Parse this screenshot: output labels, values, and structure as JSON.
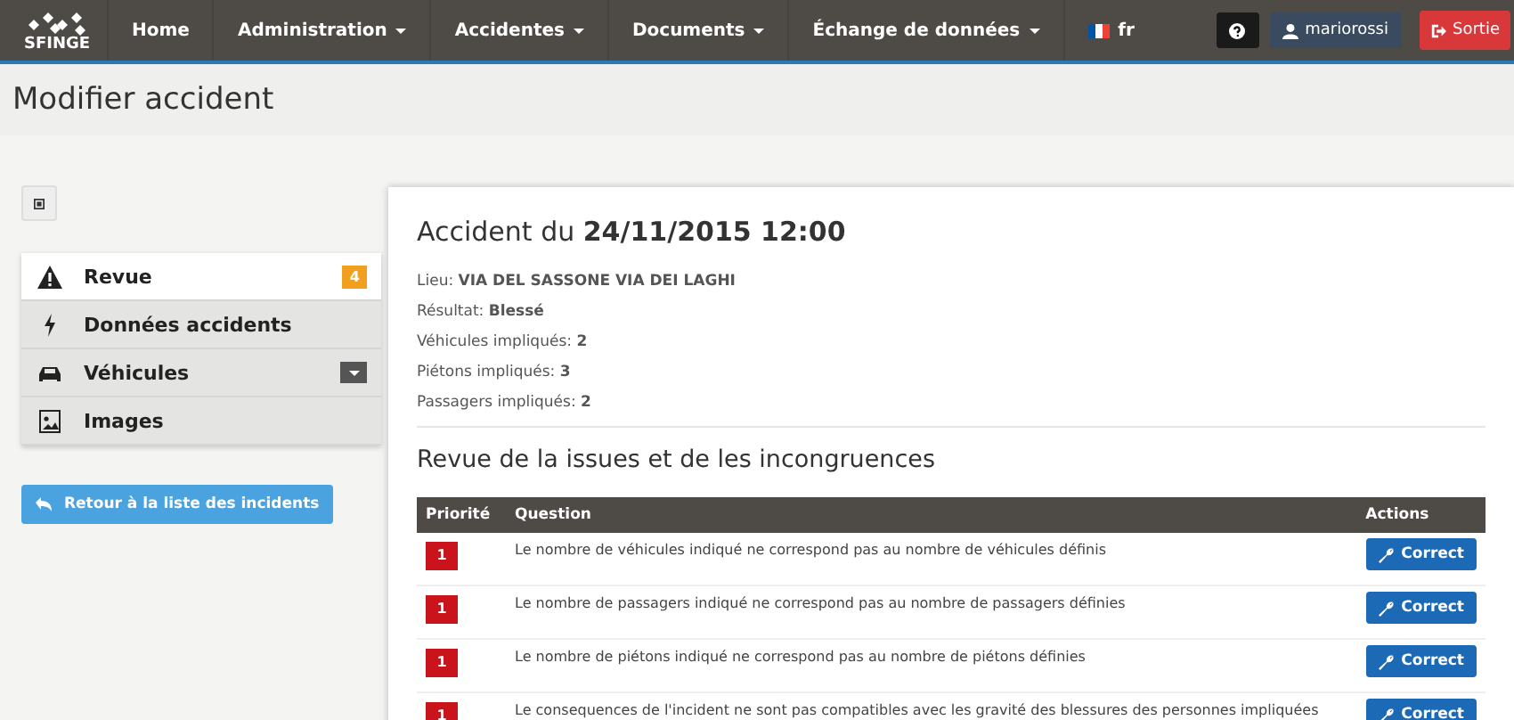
{
  "brand": "SFINGE",
  "nav": [
    {
      "label": "Home",
      "dropdown": false
    },
    {
      "label": "Administration",
      "dropdown": true
    },
    {
      "label": "Accidentes",
      "dropdown": true
    },
    {
      "label": "Documents",
      "dropdown": true
    },
    {
      "label": "Échange de données",
      "dropdown": true
    }
  ],
  "language": "fr",
  "user": "mariorossi",
  "logout": "Sortie",
  "page_title": "Modifier accident",
  "sidebar": {
    "items": [
      {
        "kind": "warning",
        "label": "Revue",
        "selected": true,
        "badge": "4",
        "expandable": false
      },
      {
        "kind": "bolt",
        "label": "Données accidents",
        "selected": false,
        "expandable": false
      },
      {
        "kind": "car",
        "label": "Véhicules",
        "selected": false,
        "expandable": true
      },
      {
        "kind": "image",
        "label": "Images",
        "selected": false,
        "expandable": false
      }
    ],
    "back_button": "Retour à la liste des incidents"
  },
  "accident": {
    "title": "Accident du **24/11/2015 12:00**",
    "details": [
      "Lieu: **VIA DEL SASSONE VIA DEI LAGHI**",
      "Résultat: **Blessé**",
      "Véhicules impliqués: **2**",
      "Piétons impliqués: **3**",
      "Passagers impliqués: **2**"
    ]
  },
  "review": {
    "title": "Revue de la issues et de les incongruences",
    "columns": [
      "Priorité",
      "Question",
      "Actions"
    ],
    "rows": [
      {
        "priority": "1",
        "question": "Le nombre de véhicules indiqué ne correspond pas au nombre de véhicules définis",
        "action": "Correct"
      },
      {
        "priority": "1",
        "question": "Le nombre de passagers indiqué ne correspond pas au nombre de passagers définies",
        "action": "Correct"
      },
      {
        "priority": "1",
        "question": "Le nombre de piétons indiqué ne correspond pas au nombre de piétons définies",
        "action": "Correct"
      },
      {
        "priority": "1",
        "question": "Le consequences de l'incident ne sont pas compatibles avec les gravité des blessures des personnes impliquées",
        "action": "Correct"
      }
    ]
  }
}
